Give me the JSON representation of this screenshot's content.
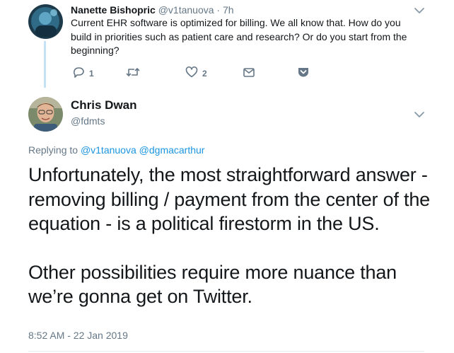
{
  "parent_tweet": {
    "author_name": "Nanette Bishopric",
    "author_handle": "@v1tanuova",
    "separator": "·",
    "time": "7h",
    "text": "Current EHR software is optimized for billing. We all know that. How do you build in priorities such as patient care and research? Or do you start from the beginning?",
    "actions": {
      "reply_count": "1",
      "retweet_count": "",
      "like_count": "2"
    }
  },
  "main_tweet": {
    "author_name": "Chris Dwan",
    "author_handle": "@fdmts",
    "replying_prefix": "Replying to",
    "replying_to": [
      "@v1tanuova",
      "@dgmacarthur"
    ],
    "paragraphs": [
      "Unfortunately, the most straightforward answer - removing billing / payment from the center of the equation - is a political firestorm in the US.",
      "Other possibilities require more nuance than we’re gonna get on Twitter."
    ],
    "timestamp": "8:52 AM - 22 Jan 2019"
  },
  "colors": {
    "text": "#14171a",
    "secondary": "#657786",
    "link": "#1b95e0",
    "thread_line": "#c4e2f5",
    "icon": "#657786"
  },
  "icons": [
    "chevron-down-icon",
    "reply-icon",
    "retweet-icon",
    "like-icon",
    "message-icon",
    "pocket-icon"
  ]
}
